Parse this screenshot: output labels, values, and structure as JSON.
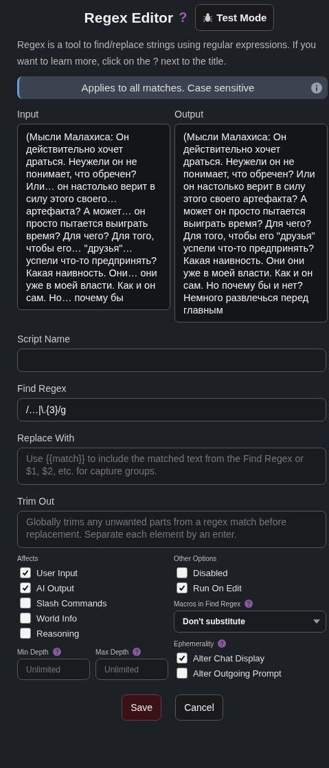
{
  "title": "Regex Editor",
  "title_help": "?",
  "test_mode_button": "Test Mode",
  "description": "Regex is a tool to find/replace strings using regular expressions. If you want to learn more, click on the ? next to the title.",
  "info_banner": "Applies to all matches. Case sensitive",
  "input": {
    "label": "Input",
    "value": "(Мысли Малахиса: Он действительно хочет драться. Неужели он не понимает, что обречен? Или… он настолько верит в силу этого своего… артефакта? А может… он просто пытается выиграть время? Для чего? Для того, чтобы его… \"друзья\"… успели что-то предпринять? Какая наивность. Они… они уже в моей власти. Как и он сам. Но… почему бы"
  },
  "output": {
    "label": "Output",
    "value": "(Мысли Малахиса: Он действительно хочет драться. Неужели он не понимает, что обречен? Или он настолько верит в силу этого своего артефакта? А может он просто пытается выиграть время? Для чего? Для того, чтобы его \"друзья\" успели что-то предпринять? Какая наивность. Они они уже в моей власти. Как и он сам. Но почему бы и нет? Немного развлечься перед главным"
  },
  "fields": [
    {
      "label": "Script Name",
      "kind": "input"
    },
    {
      "label": "Find Regex",
      "kind": "input",
      "value": "/…|\\.{3}/g"
    },
    {
      "label": "Replace With",
      "kind": "textarea",
      "placeholder": "Use {{match}} to include the matched text from the Find Regex or $1, $2, etc. for capture groups."
    },
    {
      "label": "Trim Out",
      "kind": "textarea",
      "placeholder": "Globally trims any unwanted parts from a regex match before replacement. Separate each element by an enter."
    }
  ],
  "affects": {
    "label": "Affects",
    "items": [
      {
        "label": "User Input",
        "checked": true
      },
      {
        "label": "AI Output",
        "checked": true
      },
      {
        "label": "Slash Commands",
        "checked": false
      },
      {
        "label": "World Info",
        "checked": false
      },
      {
        "label": "Reasoning",
        "checked": false
      }
    ]
  },
  "depth": [
    {
      "label": "Min Depth",
      "placeholder": "Unlimited"
    },
    {
      "label": "Max Depth",
      "placeholder": "Unlimited"
    }
  ],
  "other_options": {
    "label": "Other Options",
    "items": [
      {
        "label": "Disabled",
        "checked": false
      },
      {
        "label": "Run On Edit",
        "checked": true
      }
    ]
  },
  "macros": {
    "label": "Macros in Find Regex",
    "value": "Don't substitute"
  },
  "ephemerality": {
    "label": "Ephemerality",
    "items": [
      {
        "label": "Alter Chat Display",
        "checked": true
      },
      {
        "label": "Alter Outgoing Prompt",
        "checked": false
      }
    ]
  },
  "buttons": [
    {
      "label": "Save",
      "kind": "primary"
    },
    {
      "label": "Cancel",
      "kind": "secondary"
    }
  ]
}
